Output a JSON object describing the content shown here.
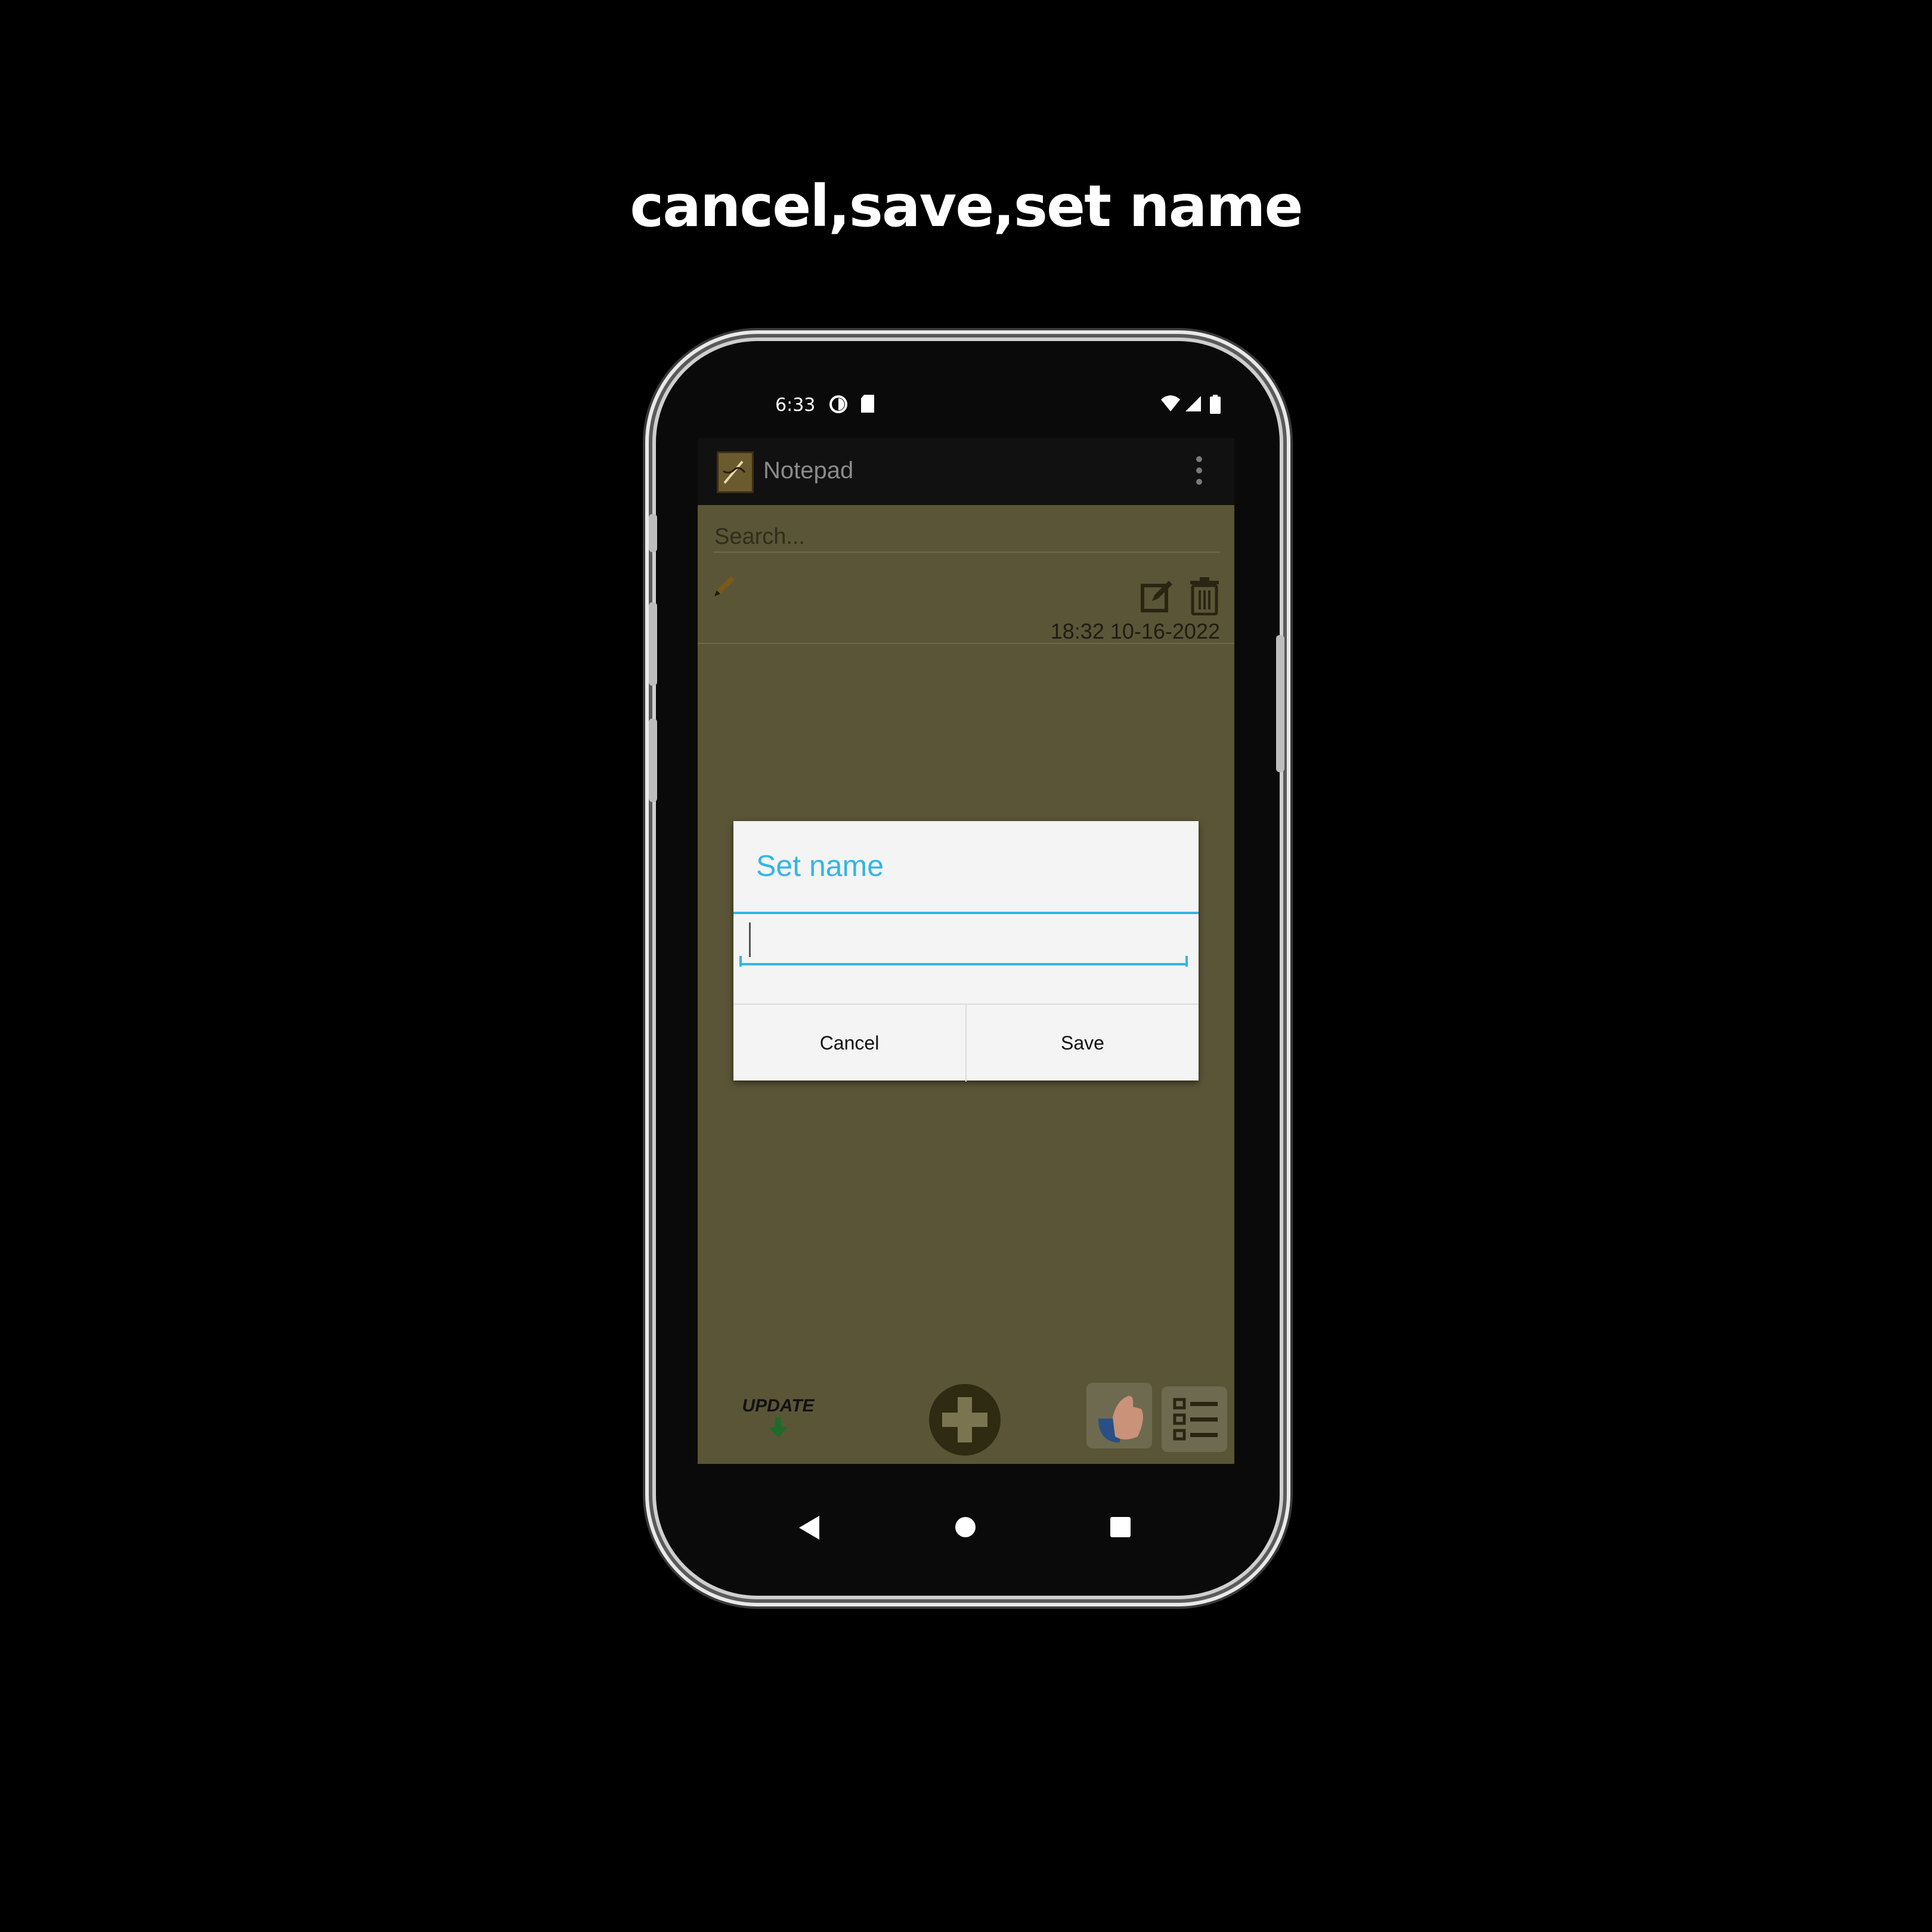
{
  "caption": "cancel,save,set name",
  "status_bar": {
    "time": "6:33",
    "icons": [
      "data-saver-icon",
      "sd-card-icon",
      "wifi-icon",
      "signal-icon",
      "battery-icon"
    ]
  },
  "app_bar": {
    "title": "Notepad",
    "logo_icon": "notepad-logo-icon",
    "menu_icon": "overflow-menu-icon"
  },
  "search": {
    "placeholder": "Search..."
  },
  "notes": [
    {
      "date": "18:32 10-16-2022",
      "icons": [
        "pencil-icon",
        "edit-icon",
        "trash-icon"
      ]
    }
  ],
  "bottom_bar": {
    "update_label": "UPDATE",
    "icons": [
      "add-icon",
      "thumbs-up-icon",
      "list-icon"
    ]
  },
  "dialog": {
    "title": "Set name",
    "input_value": "",
    "cancel_label": "Cancel",
    "save_label": "Save"
  },
  "colors": {
    "accent": "#33b5e5",
    "screen_dim": "#5a5536",
    "app_bar": "#111111"
  }
}
